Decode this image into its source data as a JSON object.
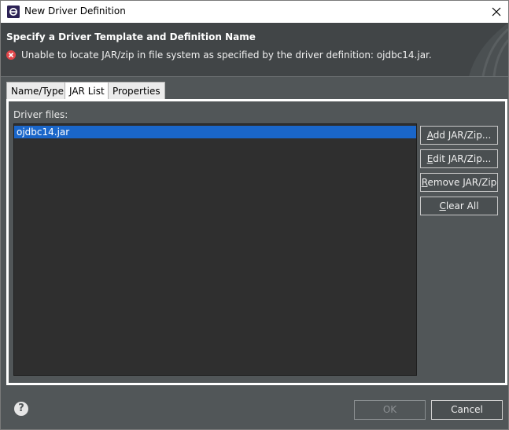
{
  "window": {
    "title": "New Driver Definition"
  },
  "banner": {
    "title": "Specify a Driver Template and Definition Name",
    "message": "Unable to locate JAR/zip in file system as specified by the driver definition: ojdbc14.jar."
  },
  "tabs": [
    {
      "label": "Name/Type",
      "active": false
    },
    {
      "label": "JAR List",
      "active": true
    },
    {
      "label": "Properties",
      "active": false
    }
  ],
  "jar_list": {
    "label": "Driver files:",
    "files": [
      "ojdbc14.jar"
    ],
    "selected_index": 0
  },
  "buttons": {
    "add": {
      "mnemonic": "A",
      "rest": "dd JAR/Zip..."
    },
    "edit": {
      "mnemonic": "E",
      "rest": "dit JAR/Zip..."
    },
    "remove": {
      "mnemonic": "R",
      "rest": "emove JAR/Zip"
    },
    "clear": {
      "mnemonic": "C",
      "rest": "lear All"
    }
  },
  "footer": {
    "help_glyph": "?",
    "ok_label": "OK",
    "cancel_label": "Cancel"
  },
  "colors": {
    "background": "#515658",
    "banner": "#414547",
    "selection": "#1a66c9",
    "error": "#e0464a"
  },
  "icons": {
    "app": "eclipse-icon",
    "close": "close-icon",
    "error": "error-icon",
    "help": "help-icon"
  }
}
